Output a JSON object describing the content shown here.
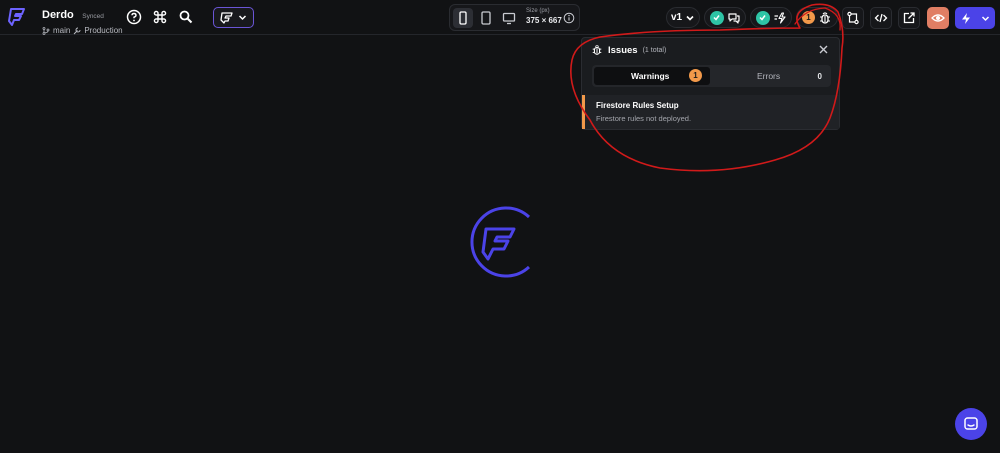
{
  "project": {
    "name": "Derdo",
    "sync_status": "Synced",
    "branch": "main",
    "environment": "Production"
  },
  "device": {
    "size_label": "Size (px)",
    "size_value": "375 × 667"
  },
  "toolbar": {
    "version": "v1",
    "warning_count": "1"
  },
  "issues": {
    "title": "Issues",
    "total": "(1 total)",
    "tabs": {
      "warnings": {
        "label": "Warnings",
        "count": "1"
      },
      "errors": {
        "label": "Errors",
        "count": "0"
      }
    },
    "items": [
      {
        "title": "Firestore Rules Setup",
        "description": "Firestore rules not deployed."
      }
    ]
  },
  "colors": {
    "accent": "#4b43e8",
    "warning": "#f2994a",
    "success": "#2ec4a5",
    "annotation": "#d11a1a"
  }
}
